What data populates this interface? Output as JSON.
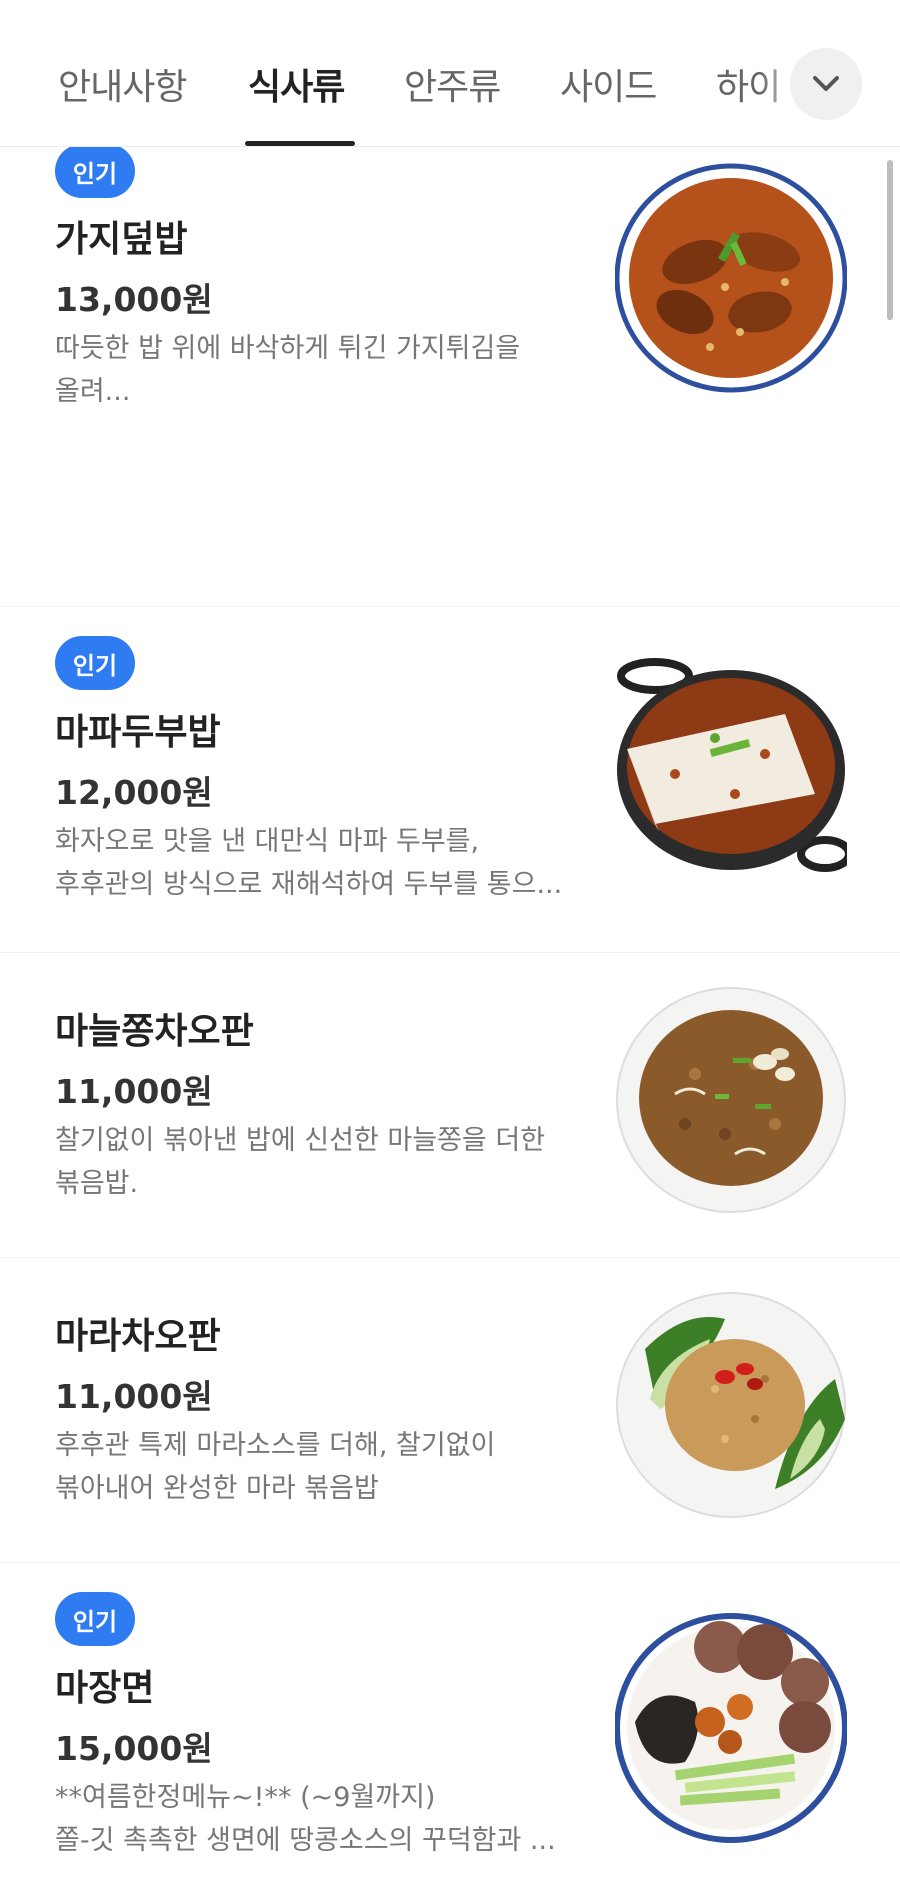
{
  "tabs": [
    {
      "label": "안내사항",
      "active": false
    },
    {
      "label": "식사류",
      "active": true
    },
    {
      "label": "안주류",
      "active": false
    },
    {
      "label": "사이드",
      "active": false
    },
    {
      "label": "하이",
      "active": false
    }
  ],
  "more_icon": "chevron-down-icon",
  "menu": [
    {
      "badge": "인기",
      "name": "가지덮밥",
      "price": "13,000원",
      "desc": [
        "따듯한 밥 위에 바삭하게 튀긴 가지튀김을",
        "올려..."
      ]
    },
    {
      "badge": "인기",
      "name": "마파두부밥",
      "price": "12,000원",
      "desc": [
        "화자오로 맛을 낸 대만식 마파 두부를,",
        "후후관의 방식으로 재해석하여 두부를 통으..."
      ]
    },
    {
      "badge": "",
      "name": "마늘쫑차오판",
      "price": "11,000원",
      "desc": [
        "찰기없이 볶아낸 밥에 신선한 마늘쫑을 더한",
        "볶음밥."
      ]
    },
    {
      "badge": "",
      "name": "마라차오판",
      "price": "11,000원",
      "desc": [
        "후후관 특제 마라소스를 더해, 찰기없이",
        "볶아내어 완성한 마라 볶음밥"
      ]
    },
    {
      "badge": "인기",
      "name": "마장면",
      "price": "15,000원",
      "desc": [
        "**여름한정메뉴~!** (~9월까지)",
        "쫄-깃 촉촉한 생면에 땅콩소스의 꾸덕함과 ..."
      ]
    }
  ],
  "colors": {
    "accent": "#2f7bf2",
    "text": "#222222",
    "muted": "#777777"
  }
}
